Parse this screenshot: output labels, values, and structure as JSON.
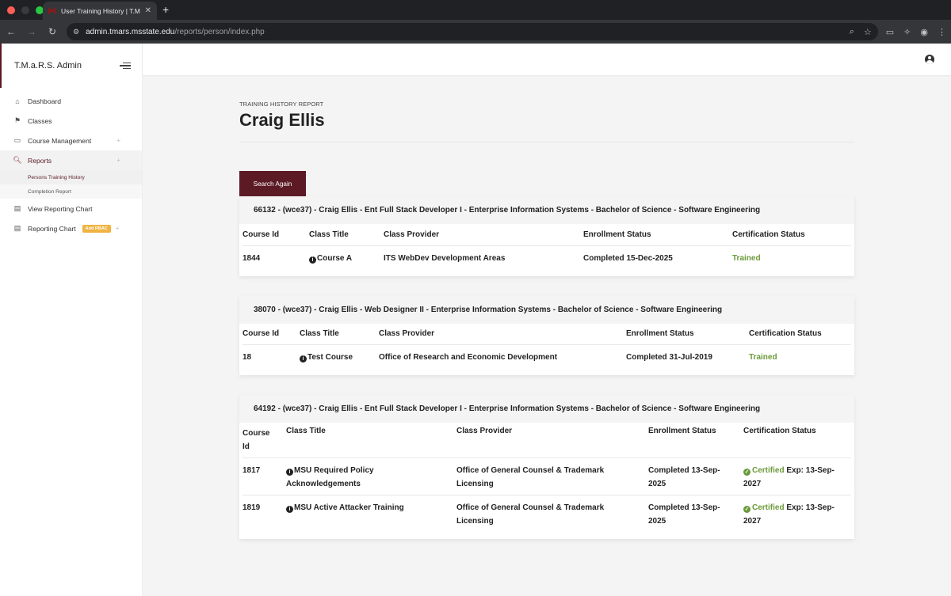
{
  "browser": {
    "tab_title": "User Training History | T.M.a.",
    "url_host": "admin.tmars.msstate.edu",
    "url_path": "/reports/person/index.php"
  },
  "colors": {
    "brand": "#5c1a24",
    "certified": "#6b9a3a",
    "badge": "#f0b340"
  },
  "sidebar": {
    "title": "T.M.a.R.S. Admin",
    "items": [
      {
        "label": "Dashboard",
        "icon": "home-icon"
      },
      {
        "label": "Classes",
        "icon": "classes-icon"
      },
      {
        "label": "Course Management",
        "icon": "laptop-icon",
        "plus": "+"
      },
      {
        "label": "Reports",
        "icon": "search-icon",
        "plus": "+"
      },
      {
        "label": "View Reporting Chart",
        "icon": "chart-icon"
      },
      {
        "label": "Reporting Chart",
        "icon": "chart-icon",
        "badge": "Add RBAC",
        "plus": "+"
      }
    ],
    "subitems": [
      {
        "label": "Persons Training History"
      },
      {
        "label": "Completion Report"
      }
    ]
  },
  "page": {
    "eyebrow": "TRAINING HISTORY REPORT",
    "name": "Craig Ellis",
    "search_again": "Search Again"
  },
  "cards": [
    {
      "header": "66132 - (wce37) - Craig Ellis - Ent Full Stack Developer I - Enterprise Information Systems - Bachelor of Science - Software Engineering",
      "columns": [
        "Course Id",
        "Class Title",
        "Class Provider",
        "Enrollment Status",
        "Certification Status"
      ],
      "rows": [
        {
          "id": "1844",
          "title": "Course A",
          "provider": "ITS WebDev Development Areas",
          "enrollment": "Completed 15-Dec-2025",
          "cert": "Trained"
        }
      ]
    },
    {
      "header": "38070 - (wce37) - Craig Ellis - Web Designer II - Enterprise Information Systems - Bachelor of Science - Software Engineering",
      "columns": [
        "Course Id",
        "Class Title",
        "Class Provider",
        "Enrollment Status",
        "Certification Status"
      ],
      "rows": [
        {
          "id": "18",
          "title": "Test Course",
          "provider": "Office of Research and Economic Development",
          "enrollment": "Completed 31-Jul-2019",
          "cert": "Trained"
        }
      ]
    },
    {
      "header": "64192 - (wce37) - Craig Ellis - Ent Full Stack Developer I - Enterprise Information Systems - Bachelor of Science - Software Engineering",
      "columns": [
        "Course Id",
        "Class Title",
        "Class Provider",
        "Enrollment Status",
        "Certification Status"
      ],
      "rows": [
        {
          "id": "1817",
          "title": "MSU Required Policy Acknowledgements",
          "provider": "Office of General Counsel & Trademark Licensing",
          "enrollment": "Completed 13-Sep-2025",
          "cert": "Certified",
          "exp": "Exp: 13-Sep-2027"
        },
        {
          "id": "1819",
          "title": "MSU Active Attacker Training",
          "provider": "Office of General Counsel & Trademark Licensing",
          "enrollment": "Completed 13-Sep-2025",
          "cert": "Certified",
          "exp": "Exp: 13-Sep-2027"
        }
      ]
    }
  ]
}
